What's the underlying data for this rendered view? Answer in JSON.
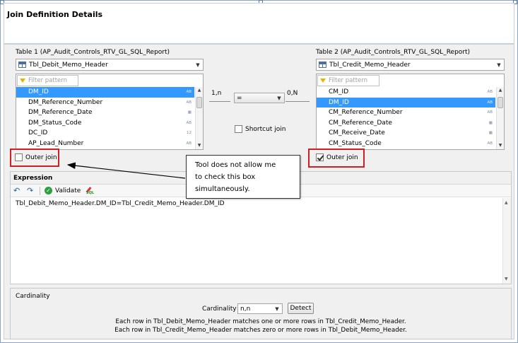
{
  "panel_title": "Join Definition Details",
  "table1": {
    "label": "Table 1 (AP_Audit_Controls_RTV_GL_SQL_Report)",
    "selected_table": "Tbl_Debit_Memo_Header",
    "filter_placeholder": "Filter pattern",
    "columns": [
      {
        "name": "DM_ID",
        "type": "AB",
        "selected": true
      },
      {
        "name": "DM_Reference_Number",
        "type": "AB",
        "selected": false
      },
      {
        "name": "DM_Reference_Date",
        "type": "date",
        "selected": false
      },
      {
        "name": "DM_Status_Code",
        "type": "AB",
        "selected": false
      },
      {
        "name": "DC_ID",
        "type": "12",
        "selected": false
      },
      {
        "name": "AP_Lead_Number",
        "type": "AB",
        "selected": false
      }
    ],
    "outer_join_label": "Outer join",
    "outer_join_checked": false
  },
  "table2": {
    "label": "Table 2 (AP_Audit_Controls_RTV_GL_SQL_Report)",
    "selected_table": "Tbl_Credit_Memo_Header",
    "filter_placeholder": "Filter pattern",
    "columns": [
      {
        "name": "CM_ID",
        "type": "AB",
        "selected": false
      },
      {
        "name": "DM_ID",
        "type": "AB",
        "selected": true
      },
      {
        "name": "CM_Reference_Number",
        "type": "AB",
        "selected": false
      },
      {
        "name": "CM_Reference_Date",
        "type": "date",
        "selected": false
      },
      {
        "name": "CM_Receive_Date",
        "type": "date",
        "selected": false
      },
      {
        "name": "CM_Status_Code",
        "type": "AB",
        "selected": false
      }
    ],
    "outer_join_label": "Outer join",
    "outer_join_checked": true
  },
  "join": {
    "left_cardinality": "1,n",
    "right_cardinality": "0,N",
    "operator": "=",
    "shortcut_join_label": "Shortcut join",
    "shortcut_join_checked": false
  },
  "callout": {
    "lines": [
      "Tool does not allow me",
      "to check this box",
      "simultaneously."
    ]
  },
  "expression": {
    "header": "Expression",
    "validate_label": "Validate",
    "sql_icon_text": "SQL",
    "text": "Tbl_Debit_Memo_Header.DM_ID=Tbl_Credit_Memo_Header.DM_ID"
  },
  "cardinality": {
    "header": "Cardinality",
    "field_label": "Cardinality",
    "value": "n,n",
    "detect_label": "Detect",
    "description_line1": "Each row in Tbl_Debit_Memo_Header matches one or more rows in Tbl_Credit_Memo_Header.",
    "description_line2": "Each row in Tbl_Credit_Memo_Header matches zero or more rows in Tbl_Debit_Memo_Header."
  },
  "colors": {
    "selection": "#3399ff",
    "highlight_box": "#d21f1f",
    "panel_bg": "#f0f0f0"
  }
}
